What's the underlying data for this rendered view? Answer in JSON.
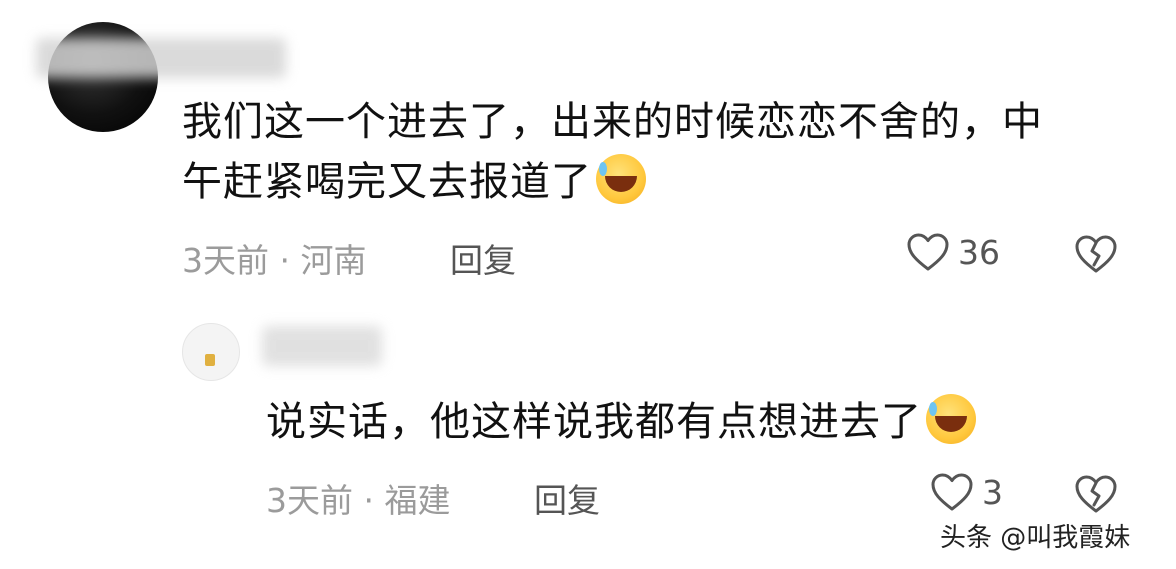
{
  "comment": {
    "text_line1": "我们这一个进去了，出来的时候恋恋不舍的，中",
    "text_line2": "午赶紧喝完又去报道了",
    "time_location": "3天前 · 河南",
    "reply_label": "回复",
    "like_count": "36"
  },
  "reply": {
    "text": "说实话，他这样说我都有点想进去了",
    "time_location": "3天前 · 福建",
    "reply_label": "回复",
    "like_count": "3"
  },
  "watermark": {
    "text": "头条 @叫我霞妹"
  },
  "icons": {
    "like": "heart-outline-icon",
    "dislike": "broken-heart-icon",
    "emoji": "rolling-laughing-emoji-icon"
  },
  "colors": {
    "meta_text": "#9b9b9b",
    "action_text": "#555555",
    "body_text": "#111111"
  }
}
